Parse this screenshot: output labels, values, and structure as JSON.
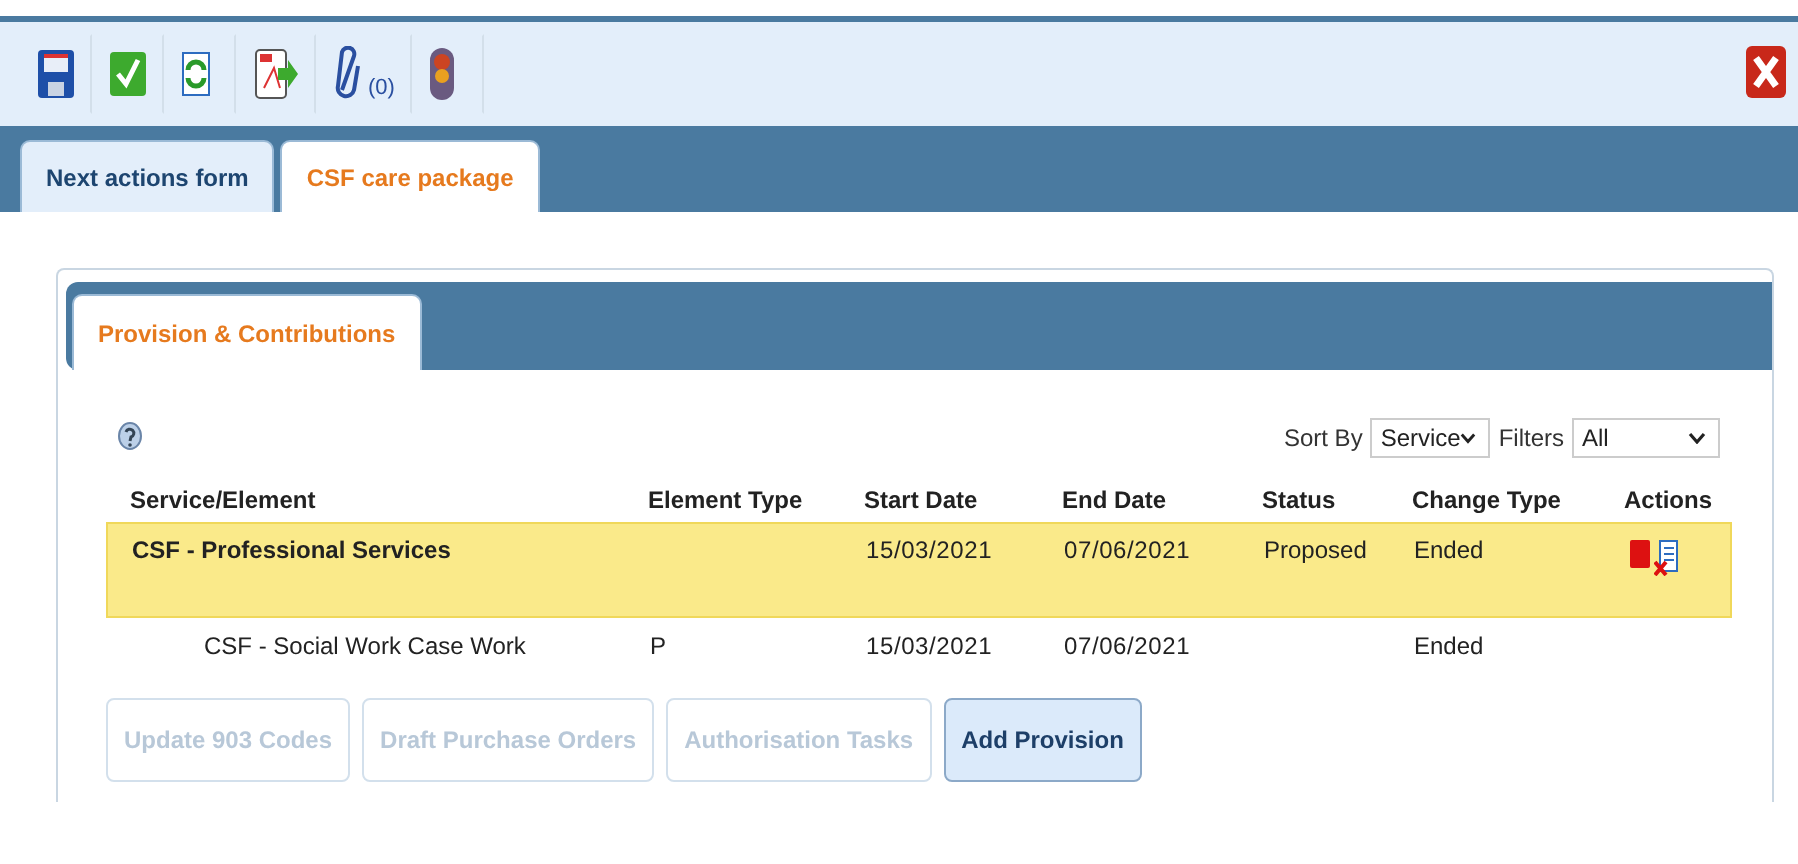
{
  "toolbar": {
    "items": [
      {
        "kind": "save"
      },
      {
        "kind": "check"
      },
      {
        "kind": "refresh"
      },
      {
        "kind": "pdf"
      },
      {
        "kind": "attach",
        "count": "(0)"
      },
      {
        "kind": "traffic"
      }
    ]
  },
  "tabs": [
    {
      "label": "Next actions form",
      "selected": false
    },
    {
      "label": "CSF care package",
      "selected": true
    }
  ],
  "panel": {
    "tabs": [
      {
        "label": "Provision & Contributions",
        "selected": true
      }
    ],
    "sort_by": {
      "label": "Sort By",
      "value": "Service"
    },
    "filters": {
      "label": "Filters",
      "value": "All"
    },
    "table": {
      "columns": [
        "Service/Element",
        "Element Type",
        "Start Date",
        "End Date",
        "Status",
        "Change Type",
        "Actions"
      ],
      "rows": [
        {
          "service": "CSF - Professional Services",
          "start": "15/03/2021",
          "end": "07/06/2021",
          "status": "Proposed",
          "change_type": "Ended",
          "selected": true,
          "actions": true,
          "children": [
            {
              "service": "CSF - Social Work Case Work",
              "element_type": "P",
              "start": "15/03/2021",
              "end": "07/06/2021",
              "change_type": "Ended",
              "selected": false,
              "actions": false
            }
          ]
        }
      ]
    },
    "buttons": [
      {
        "label": "Update 903 Codes",
        "disabled": true
      },
      {
        "label": "Draft Purchase Orders",
        "disabled": true
      },
      {
        "label": "Authorisation Tasks",
        "disabled": true
      },
      {
        "label": "Add Provision",
        "disabled": false
      }
    ]
  }
}
